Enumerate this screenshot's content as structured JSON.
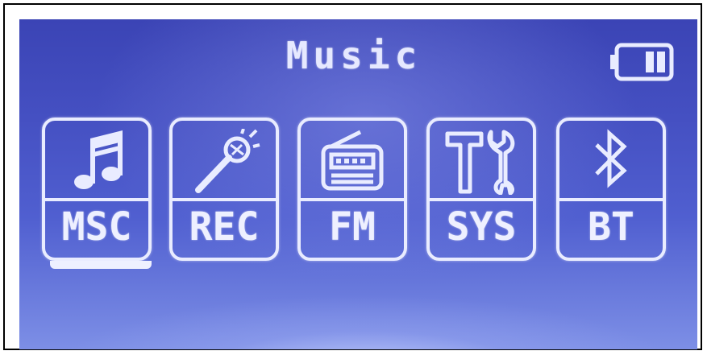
{
  "screen": {
    "title": "Music",
    "battery_icon": "battery-icon",
    "colors": {
      "background": "#4550c2",
      "foreground": "#e9ecff"
    }
  },
  "menu": {
    "selected": "MSC",
    "items": [
      {
        "label": "MSC",
        "icon": "music-note-icon"
      },
      {
        "label": "REC",
        "icon": "microphone-icon"
      },
      {
        "label": "FM",
        "icon": "radio-icon"
      },
      {
        "label": "SYS",
        "icon": "tools-icon"
      },
      {
        "label": "BT",
        "icon": "bluetooth-icon"
      }
    ]
  }
}
